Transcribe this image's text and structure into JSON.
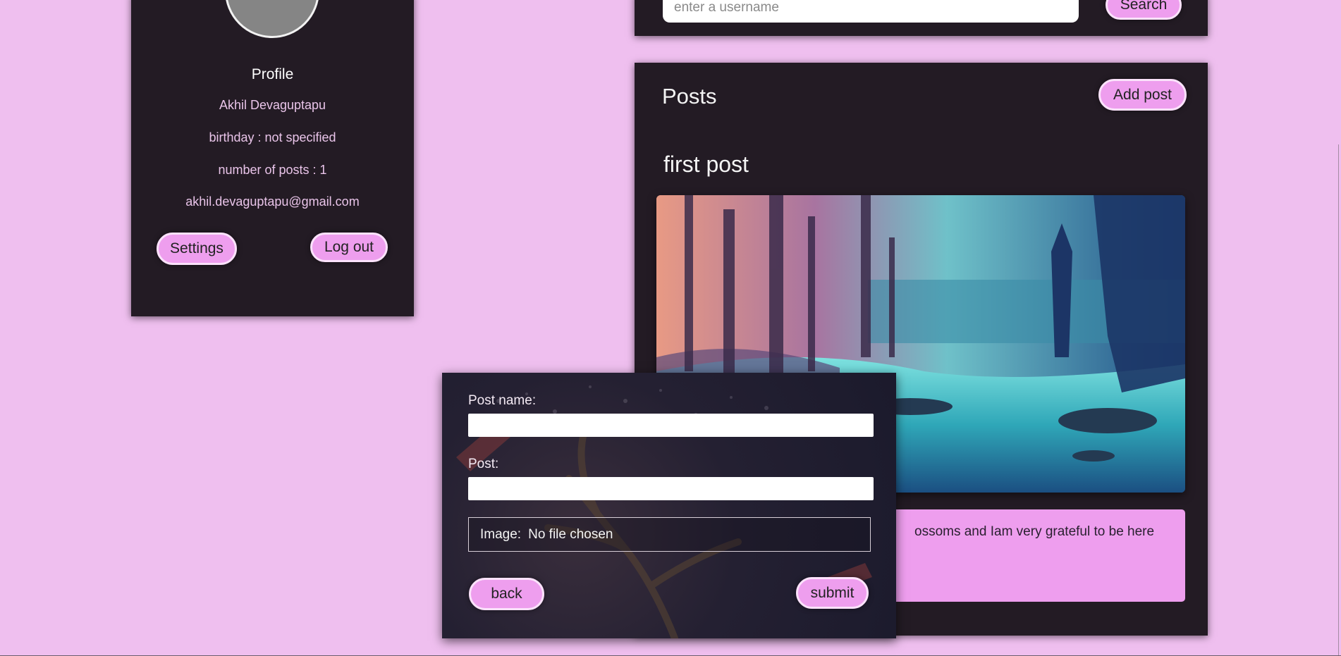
{
  "profile": {
    "title": "Profile",
    "name": "Akhil Devaguptapu",
    "birthday": "birthday : not specified",
    "posts_count": "number of posts : 1",
    "email": "akhil.devaguptapu@gmail.com",
    "settings_label": "Settings",
    "logout_label": "Log out"
  },
  "search": {
    "placeholder": "enter a username",
    "button_label": "Search"
  },
  "posts": {
    "title": "Posts",
    "add_label": "Add post",
    "items": [
      {
        "title": "first post",
        "body_visible": "ossoms and Iam very grateful to be here"
      }
    ]
  },
  "modal": {
    "post_name_label": "Post name:",
    "post_label": "Post:",
    "image_label": "Image:",
    "file_status": "No file chosen",
    "back_label": "back",
    "submit_label": "submit"
  },
  "colors": {
    "page_bg": "#efbfef",
    "panel_bg": "#231b24",
    "accent_pill": "#ee9eee"
  }
}
